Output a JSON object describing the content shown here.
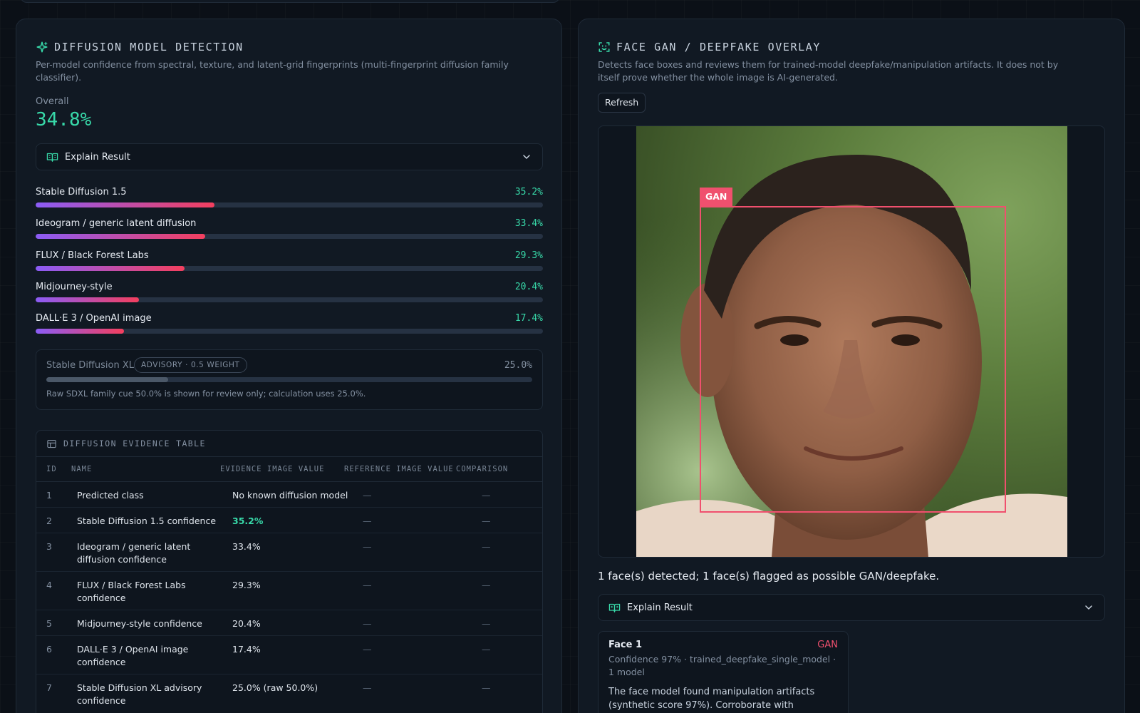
{
  "diffusion": {
    "title": "DIFFUSION MODEL DETECTION",
    "description": "Per-model confidence from spectral, texture, and latent-grid fingerprints (multi-fingerprint diffusion family classifier).",
    "overall_label": "Overall",
    "overall_value": "34.8%",
    "explain_label": "Explain Result",
    "models": [
      {
        "name": "Stable Diffusion 1.5",
        "pct": "35.2%",
        "value": 35.2
      },
      {
        "name": "Ideogram / generic latent diffusion",
        "pct": "33.4%",
        "value": 33.4
      },
      {
        "name": "FLUX / Black Forest Labs",
        "pct": "29.3%",
        "value": 29.3
      },
      {
        "name": "Midjourney-style",
        "pct": "20.4%",
        "value": 20.4
      },
      {
        "name": "DALL·E 3 / OpenAI image",
        "pct": "17.4%",
        "value": 17.4
      }
    ],
    "advisory": {
      "name": "Stable Diffusion XL",
      "badge": "ADVISORY · 0.5 WEIGHT",
      "pct": "25.0%",
      "value": 25.0,
      "note": "Raw SDXL family cue 50.0% is shown for review only; calculation uses 25.0%."
    },
    "evidence_table": {
      "title": "DIFFUSION EVIDENCE TABLE",
      "columns": [
        "ID",
        "NAME",
        "EVIDENCE IMAGE VALUE",
        "REFERENCE IMAGE VALUE",
        "COMPARISON"
      ],
      "rows": [
        {
          "id": "1",
          "name": "Predicted class",
          "value": "No known diffusion model",
          "ref": "—",
          "cmp": "—"
        },
        {
          "id": "2",
          "name": "Stable Diffusion 1.5 confidence",
          "value": "35.2%",
          "ref": "—",
          "cmp": "—"
        },
        {
          "id": "3",
          "name": "Ideogram / generic latent diffusion confidence",
          "value": "33.4%",
          "ref": "—",
          "cmp": "—"
        },
        {
          "id": "4",
          "name": "FLUX / Black Forest Labs confidence",
          "value": "29.3%",
          "ref": "—",
          "cmp": "—"
        },
        {
          "id": "5",
          "name": "Midjourney-style confidence",
          "value": "20.4%",
          "ref": "—",
          "cmp": "—"
        },
        {
          "id": "6",
          "name": "DALL·E 3 / OpenAI image confidence",
          "value": "17.4%",
          "ref": "—",
          "cmp": "—"
        },
        {
          "id": "7",
          "name": "Stable Diffusion XL advisory confidence",
          "value": "25.0% (raw 50.0%)",
          "ref": "—",
          "cmp": "—"
        }
      ]
    }
  },
  "face": {
    "title": "FACE GAN / DEEPFAKE OVERLAY",
    "description": "Detects face boxes and reviews them for trained-model deepfake/manipulation artifacts. It does not by itself prove whether the whole image is AI-generated.",
    "refresh_label": "Refresh",
    "box_label": "GAN",
    "summary": "1 face(s) detected; 1 face(s) flagged as possible GAN/deepfake.",
    "explain_label": "Explain Result",
    "card": {
      "title": "Face 1",
      "flag": "GAN",
      "meta": "Confidence 97% · trained_deepfake_single_model · 1 model",
      "text": "The face model found manipulation artifacts (synthetic score 97%). Corroborate with"
    }
  },
  "colors": {
    "accent": "#38d9a9",
    "danger": "#f0506e",
    "bar_start": "#8b5cf6",
    "bar_end": "#f43f5e"
  },
  "icons": {
    "diffusion": "sparkle-icon",
    "face": "face-scan-icon",
    "explain": "book-icon",
    "table": "table-icon",
    "expand": "chevron-down-icon"
  }
}
